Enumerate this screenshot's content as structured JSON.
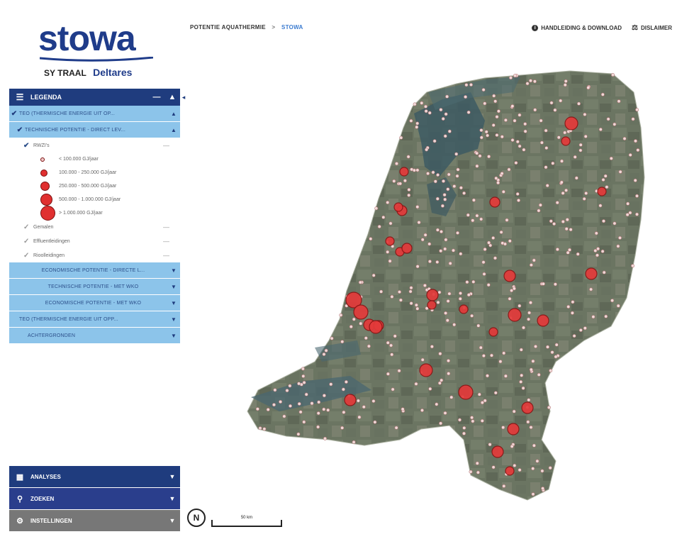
{
  "logo": {
    "title": "stowa",
    "partner1": "SY TRAAL",
    "partner2": "Deltares"
  },
  "header": {
    "breadcrumb_root": "POTENTIE AQUATHERMIE",
    "breadcrumb_sep": ">",
    "breadcrumb_current": "STOWA",
    "link_manual": "HANDLEIDING & DOWNLOAD",
    "link_disclaimer": "DISLAIMER"
  },
  "legend": {
    "title": "LEGENDA",
    "min_label": "—",
    "up_label": "▲",
    "groups": [
      {
        "label": "TEO (THERMISCHE ENERGIE UIT OP...",
        "checked": true
      },
      {
        "label": "TECHNISCHE POTENTIE - DIRECT LEV...",
        "checked": true
      }
    ],
    "sub_top": {
      "label": "RWZI's",
      "checked": true
    },
    "classes": [
      {
        "label": "< 100.000 GJ/jaar",
        "size": 6
      },
      {
        "label": "100.000 - 250.000 GJ/jaar",
        "size": 10
      },
      {
        "label": "250.000 - 500.000 GJ/jaar",
        "size": 13
      },
      {
        "label": "500.000 - 1.000.000 GJ/jaar",
        "size": 17
      },
      {
        "label": "> 1.000.000 GJ/jaar",
        "size": 21
      }
    ],
    "subs": [
      {
        "label": "Gemalen",
        "checked": false
      },
      {
        "label": "Effluentleidingen",
        "checked": false
      },
      {
        "label": "Rioolleidingen",
        "checked": false
      }
    ],
    "more": [
      "ECONOMISCHE POTENTIE - DIRECTE L...",
      "TECHNISCHE POTENTIE - MET WKO",
      "ECONOMISCHE POTENTIE - MET WKO",
      "TEO (THERMISCHE ENERGIE UIT OPP...",
      "ACHTERGRONDEN"
    ]
  },
  "tools": [
    {
      "label": "ANALYSES",
      "icon": "calculator-icon"
    },
    {
      "label": "ZOEKEN",
      "icon": "search-icon"
    },
    {
      "label": "INSTELLINGEN",
      "icon": "gear-icon"
    }
  ],
  "map": {
    "compass_label": "N",
    "scale_label": "50 km",
    "marker_color": "#e43a3a",
    "marker_border": "#8a1414",
    "small_marker_color": "#f6dede"
  }
}
